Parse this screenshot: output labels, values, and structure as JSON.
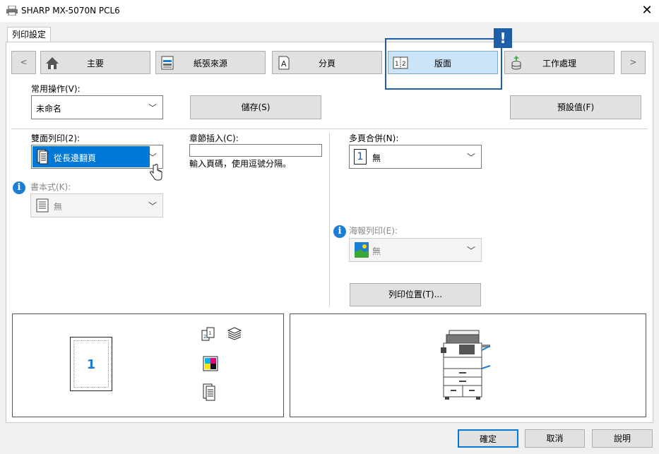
{
  "window": {
    "title": "SHARP MX-5070N PCL6",
    "close_glyph": "✕"
  },
  "tab": {
    "label": "列印設定"
  },
  "nav": {
    "prev": "<",
    "next": ">",
    "items": [
      {
        "label": "主要"
      },
      {
        "label": "紙張來源"
      },
      {
        "label": "分頁"
      },
      {
        "label": "版面"
      },
      {
        "label": "工作處理"
      }
    ],
    "warning_badge": "!"
  },
  "common": {
    "label": "常用操作(V):",
    "value": "未命名",
    "save_button": "儲存(S)",
    "defaults_button": "預設值(F)"
  },
  "duplex": {
    "label": "雙面列印(2):",
    "value": "從長邊翻頁"
  },
  "booklet": {
    "label": "書本式(K):",
    "value": "無"
  },
  "chapter": {
    "label": "章節插入(C):",
    "value": "",
    "hint": "輸入頁碼，使用逗號分隔。"
  },
  "nup": {
    "label": "多頁合併(N):",
    "value": "無",
    "icon_text": "1"
  },
  "poster": {
    "label": "海報列印(E):",
    "value": "無"
  },
  "print_position_button": "列印位置(T)...",
  "preview": {
    "page_number": "1"
  },
  "footer": {
    "ok": "確定",
    "cancel": "取消",
    "help": "說明"
  },
  "colors": {
    "accent": "#1f5fa8",
    "selection": "#0078d7",
    "info": "#1a7fd4"
  }
}
